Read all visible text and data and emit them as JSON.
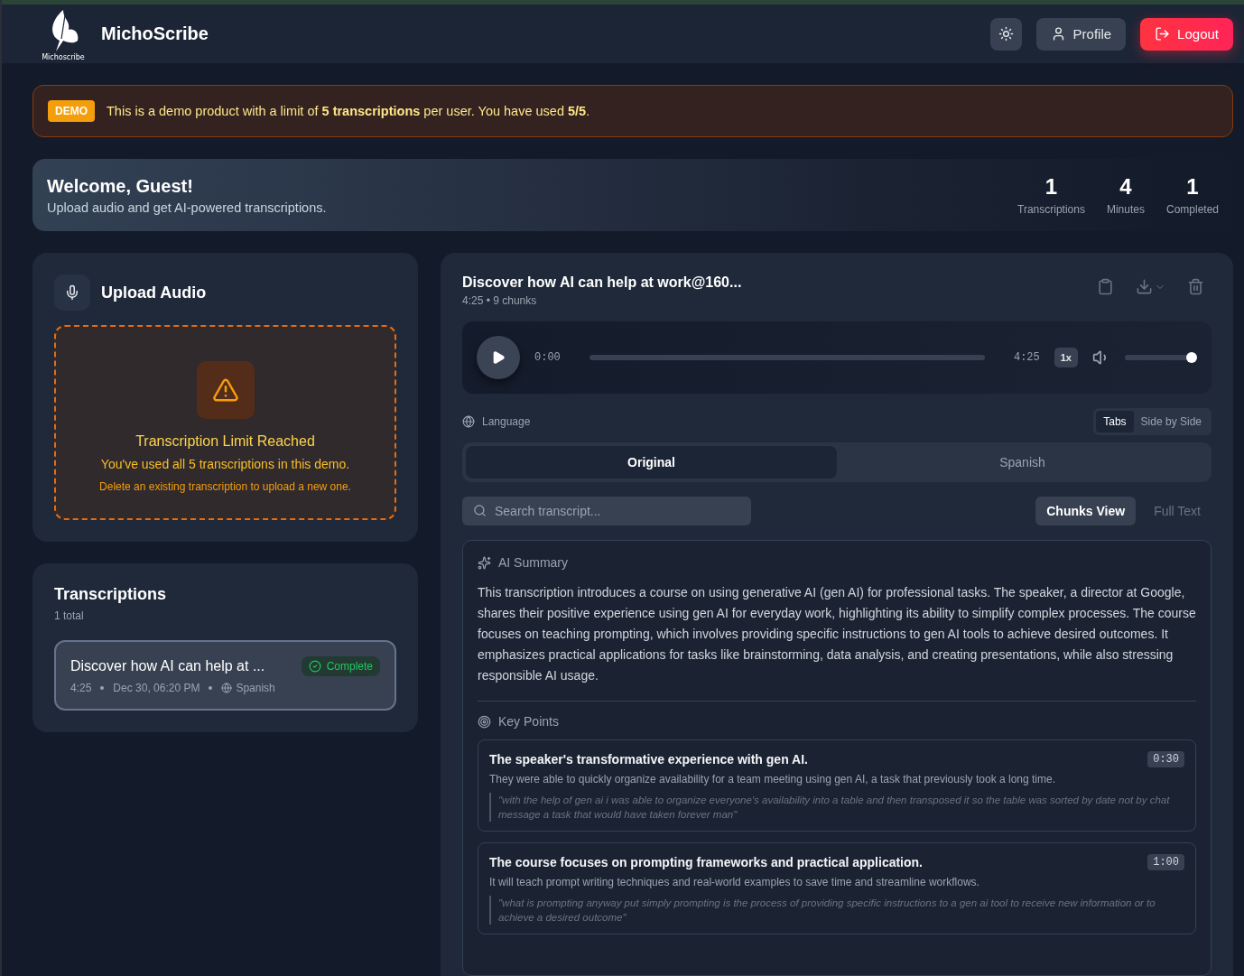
{
  "header": {
    "logo_text": "Michoscribe",
    "brand": "MichoScribe",
    "buttons": [
      {
        "kind": "theme"
      },
      {
        "kind": "profile",
        "label": "Profile"
      },
      {
        "kind": "logout",
        "label": "Logout"
      }
    ]
  },
  "banner": {
    "badge": "DEMO",
    "text": "This is a demo product with a limit of **5 transcriptions** per user. You have used **5/5**."
  },
  "welcome": {
    "title": "Welcome, Guest!",
    "subtitle": "Upload audio and get AI-powered transcriptions.",
    "stats": [
      {
        "value": "1",
        "label": "Transcriptions"
      },
      {
        "value": "4",
        "label": "Minutes"
      },
      {
        "value": "1",
        "label": "Completed"
      }
    ]
  },
  "upload": {
    "title": "Upload Audio",
    "limit": {
      "title": "Transcription Limit Reached",
      "message": "You've used all 5 transcriptions in this demo.",
      "hint": "Delete an existing transcription to upload a new one."
    }
  },
  "transcriptions": {
    "title": "Transcriptions",
    "count": "1 total",
    "items": [
      {
        "title": "Discover how AI can help at ...",
        "status": "Complete",
        "duration": "4:25",
        "date": "Dec 30, 06:20 PM",
        "language": "Spanish",
        "selected": true
      }
    ]
  },
  "detail": {
    "title": "Discover how AI can help at work@160...",
    "meta": "4:25 • 9 chunks",
    "player": {
      "current": "0:00",
      "total": "4:25",
      "progress": {
        "level": 0
      },
      "speed": "1x",
      "volume": {
        "level": 1
      }
    },
    "language_label": "Language",
    "layout_modes": [
      {
        "label": "Tabs",
        "selected": true
      },
      {
        "label": "Side by Side",
        "selected": false
      }
    ],
    "language_tabs": [
      {
        "label": "Original",
        "selected": true
      },
      {
        "label": "Spanish",
        "selected": false
      }
    ],
    "search": {
      "placeholder": "Search transcript..."
    },
    "view_modes": [
      {
        "label": "Chunks View",
        "selected": true
      },
      {
        "label": "Full Text",
        "selected": false
      }
    ],
    "summary": {
      "title": "AI Summary",
      "text": "This transcription introduces a course on using generative AI (gen AI) for professional tasks. The speaker, a director at Google, shares their positive experience using gen AI for everyday work, highlighting its ability to simplify complex processes. The course focuses on teaching prompting, which involves providing specific instructions to gen AI tools to achieve desired outcomes. It emphasizes practical applications for tasks like brainstorming, data analysis, and creating presentations, while also stressing responsible AI usage."
    },
    "key_points": {
      "title": "Key Points",
      "items": [
        {
          "title": "The speaker's transformative experience with gen AI.",
          "time": "0:30",
          "description": "They were able to quickly organize availability for a team meeting using gen AI, a task that previously took a long time.",
          "quote": "\"with the help of gen ai i was able to organize everyone's availability into a table and then transposed it so the table was sorted by date not by chat message a task that would have taken forever man\""
        },
        {
          "title": "The course focuses on prompting frameworks and practical application.",
          "time": "1:00",
          "description": "It will teach prompt writing techniques and real-world examples to save time and streamline workflows.",
          "quote": "\"what is prompting anyway put simply prompting is the process of providing specific instructions to a gen ai tool to receive new information or to achieve a desired outcome\""
        }
      ]
    }
  }
}
